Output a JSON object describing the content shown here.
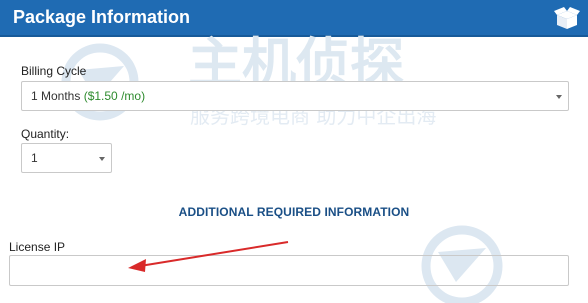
{
  "header": {
    "title": "Package Information",
    "icon": "open-box-icon",
    "background": "#1f6bb3"
  },
  "billing": {
    "label": "Billing Cycle",
    "selected_term": "1 Months",
    "selected_price": "($1.50 /mo)"
  },
  "quantity": {
    "label": "Quantity:",
    "selected": "1"
  },
  "additional": {
    "heading": "ADDITIONAL REQUIRED INFORMATION"
  },
  "license": {
    "label": "License IP",
    "value": ""
  },
  "watermark": {
    "line1": "主机侦探",
    "line2": "服务跨境电商 助力中企出海",
    "color": "#dbe6f0"
  },
  "annotation": {
    "arrow_color": "#d92a2a"
  }
}
